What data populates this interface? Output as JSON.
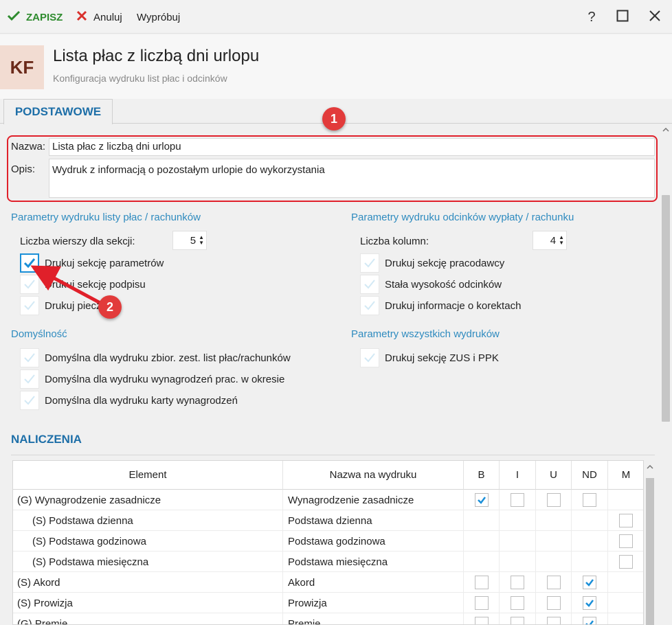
{
  "toolbar": {
    "save_label": "ZAPISZ",
    "cancel_label": "Anuluj",
    "try_label": "Wypróbuj"
  },
  "window": {
    "help": "?",
    "maximize": "☐",
    "close": "✕"
  },
  "header": {
    "logo": "KF",
    "title": "Lista płac z liczbą dni urlopu",
    "subtitle": "Konfiguracja wydruku list płac i odcinków"
  },
  "tabs": [
    {
      "label": "PODSTAWOWE"
    }
  ],
  "form": {
    "name_label": "Nazwa:",
    "name_value": "Lista płac z liczbą dni urlopu",
    "desc_label": "Opis:",
    "desc_value": "Wydruk z informacją o pozostałym urlopie do wykorzystania"
  },
  "left": {
    "section1": "Parametry wydruku listy płac / rachunków",
    "rows_label": "Liczba wierszy dla sekcji:",
    "rows_value": "5",
    "checks": [
      {
        "label": "Drukuj sekcję parametrów",
        "checked": true
      },
      {
        "label": "Drukuj sekcję podpisu",
        "checked": false
      },
      {
        "label": "Drukuj pieczątki",
        "checked": false
      }
    ],
    "section2": "Domyślność",
    "defaults": [
      {
        "label": "Domyślna dla wydruku zbior. zest. list płac/rachunków",
        "checked": false
      },
      {
        "label": "Domyślna dla wydruku wynagrodzeń prac. w okresie",
        "checked": false
      },
      {
        "label": "Domyślna dla wydruku karty wynagrodzeń",
        "checked": false
      }
    ]
  },
  "right": {
    "section1": "Parametry wydruku odcinków wypłaty / rachunku",
    "cols_label": "Liczba kolumn:",
    "cols_value": "4",
    "checks": [
      {
        "label": "Drukuj sekcję pracodawcy",
        "checked": false
      },
      {
        "label": "Stała wysokość odcinków",
        "checked": false
      },
      {
        "label": "Drukuj informacje o korektach",
        "checked": false
      }
    ],
    "section2": "Parametry wszystkich wydruków",
    "all": [
      {
        "label": "Drukuj sekcję ZUS i PPK",
        "checked": false
      }
    ]
  },
  "naliczenia": {
    "title": "NALICZENIA",
    "columns": [
      "Element",
      "Nazwa na wydruku",
      "B",
      "I",
      "U",
      "ND",
      "M"
    ],
    "rows": [
      {
        "element": "(G) Wynagrodzenie zasadnicze",
        "print_name": "Wynagrodzenie zasadnicze",
        "B": true,
        "I": false,
        "U": false,
        "ND": false,
        "M": null
      },
      {
        "element": "(S) Podstawa dzienna",
        "print_name": "Podstawa dzienna",
        "B": null,
        "I": null,
        "U": null,
        "ND": null,
        "M": false
      },
      {
        "element": "(S) Podstawa godzinowa",
        "print_name": "Podstawa godzinowa",
        "B": null,
        "I": null,
        "U": null,
        "ND": null,
        "M": false
      },
      {
        "element": "(S) Podstawa miesięczna",
        "print_name": "Podstawa miesięczna",
        "B": null,
        "I": null,
        "U": null,
        "ND": null,
        "M": false
      },
      {
        "element": "(S) Akord",
        "print_name": "Akord",
        "B": false,
        "I": false,
        "U": false,
        "ND": true,
        "M": null
      },
      {
        "element": "(S) Prowizja",
        "print_name": "Prowizja",
        "B": false,
        "I": false,
        "U": false,
        "ND": true,
        "M": null
      },
      {
        "element": "(G) Premie",
        "print_name": "Premie",
        "B": false,
        "I": false,
        "U": false,
        "ND": true,
        "M": null
      }
    ]
  },
  "annotations": [
    "1",
    "2"
  ],
  "colors": {
    "accent": "#2f8bbf",
    "brand": "#1e6fa8",
    "save_green": "#2e8b2e",
    "annotation_red": "#e0202a",
    "check_blue": "#1a8fd8"
  }
}
